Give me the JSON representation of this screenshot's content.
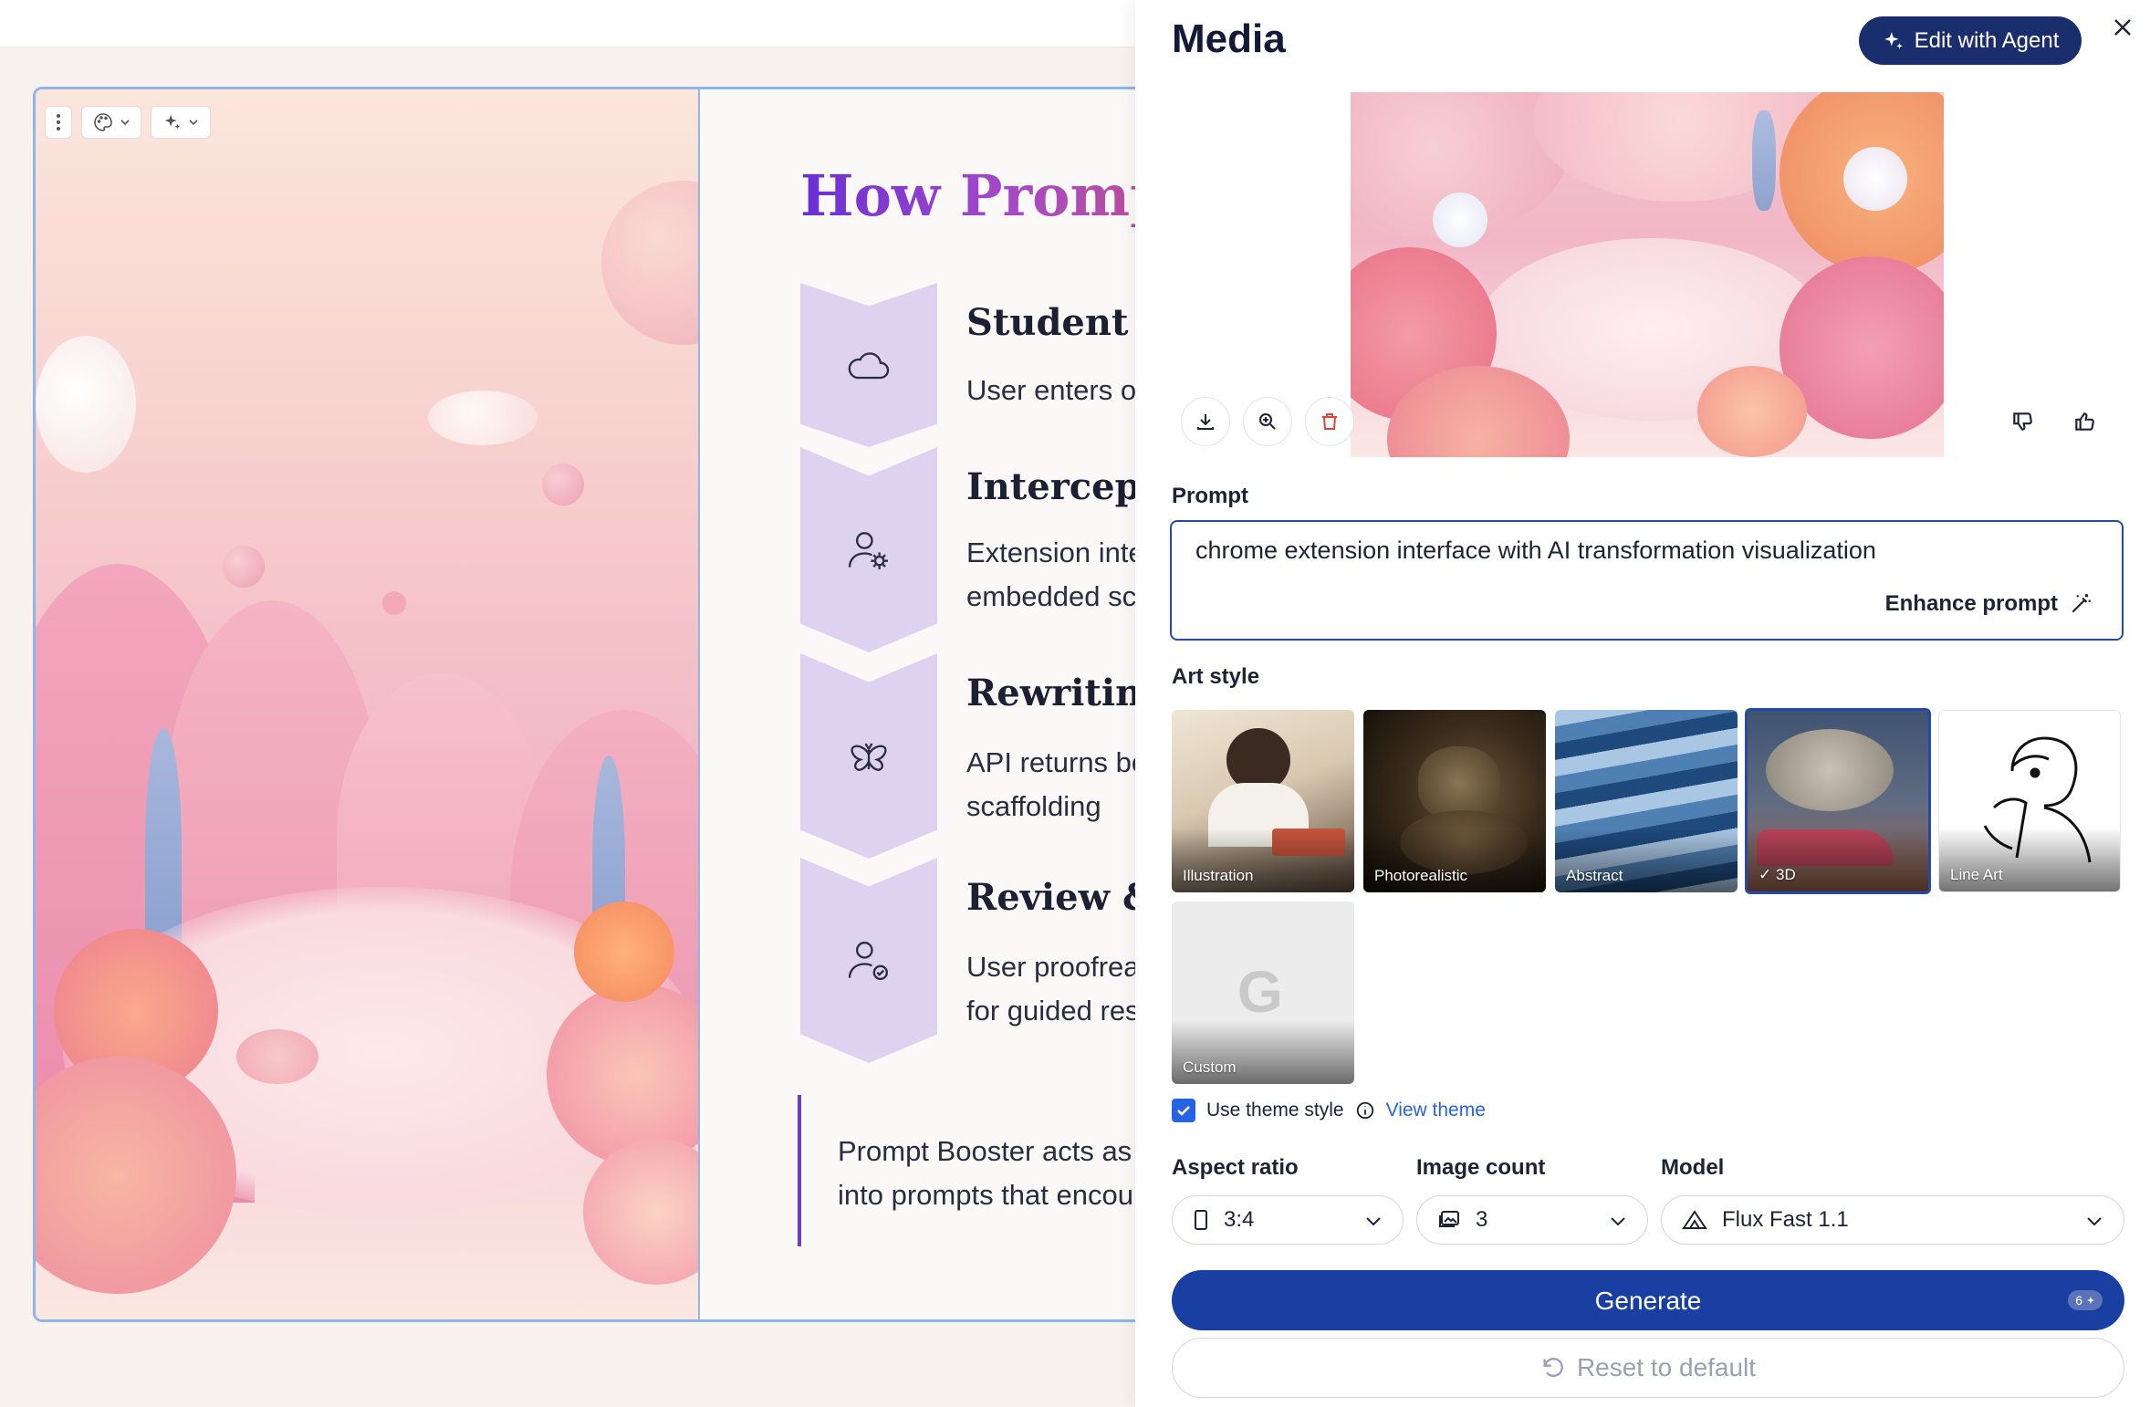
{
  "slide": {
    "title": "How Prompt",
    "steps": [
      {
        "title": "Student In",
        "text": "User enters or",
        "icon": "cloud-icon"
      },
      {
        "title": "Interceptio",
        "text": "Extension inte\nembedded sca",
        "icon": "user-gear-icon"
      },
      {
        "title": "Rewriting",
        "text": "API returns bo\nscaffolding",
        "icon": "butterfly-icon"
      },
      {
        "title": "Review & S",
        "text": "User proofrea\nfor guided res",
        "icon": "user-check-icon"
      }
    ],
    "quote": "Prompt Booster acts as\ninto prompts that encou"
  },
  "toolbar": {
    "icons": [
      "more-vertical-icon",
      "palette-icon",
      "sparkle-icon"
    ]
  },
  "panel": {
    "title": "Media",
    "agent_button": "Edit with Agent",
    "prompt_label": "Prompt",
    "prompt_value": "chrome extension interface with AI transformation visualization",
    "enhance_label": "Enhance prompt",
    "art_style_label": "Art style",
    "styles": [
      {
        "label": "Illustration",
        "selected": false
      },
      {
        "label": "Photorealistic",
        "selected": false
      },
      {
        "label": "Abstract",
        "selected": false
      },
      {
        "label": "3D",
        "selected": true
      },
      {
        "label": "Line Art",
        "selected": false
      },
      {
        "label": "Custom",
        "selected": false
      }
    ],
    "use_theme_label": "Use theme style",
    "use_theme_checked": true,
    "view_theme_label": "View theme",
    "aspect_label": "Aspect ratio",
    "aspect_value": "3:4",
    "count_label": "Image count",
    "count_value": "3",
    "model_label": "Model",
    "model_value": "Flux Fast 1.1",
    "generate_label": "Generate",
    "generate_credits": "6",
    "reset_label": "Reset to default"
  },
  "colors": {
    "primary": "#1a3fa2",
    "agent": "#1a2e6e",
    "accent_blue": "#2663e3",
    "chevron": "#ddd3f1",
    "title_gradient": [
      "#6a2fd6",
      "#c2518f"
    ]
  }
}
